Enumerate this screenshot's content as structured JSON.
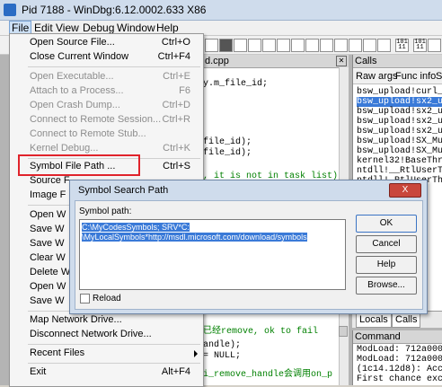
{
  "window": {
    "title": "Pid 7188 - WinDbg:6.12.0002.633 X86"
  },
  "menubar": [
    "File",
    "Edit",
    "View",
    "Debug",
    "Window",
    "Help"
  ],
  "toolbar_labels": [
    "101 11",
    "101 11"
  ],
  "source_pane": {
    "tab_title": "d.cpp",
    "lines": [
      "y.m_file_id;",
      "file_id);",
      "file_id);",
      ", it is not in task list)",
      "已经remove, ok to fail",
      "andle);",
      "= NULL;",
      "i_remove_handle会调用on_p"
    ]
  },
  "calls_pane": {
    "title": "Calls",
    "buttons": [
      "Raw args",
      "Func info",
      "S"
    ],
    "items": [
      "bsw_upload!curl_",
      "bsw_upload!sx2_u",
      "bsw_upload!sx2_u",
      "bsw_upload!sx2_u",
      "bsw_upload!sx2_u",
      "bsw_upload!SX_Mu",
      "bsw_upload!SX_Mu",
      "kernel32!BaseThr",
      "ntdll!__RtlUserT",
      "ntdll!_RtlUserThr"
    ]
  },
  "bottom_tabs": [
    "Locals",
    "Calls"
  ],
  "command_pane": {
    "title": "Command",
    "lines": [
      "ModLoad: 712a000",
      "ModLoad: 712a000",
      "(1c14.12d8): Acce",
      "First chance exce"
    ]
  },
  "file_menu": {
    "items": [
      {
        "label": "Open Source File...",
        "shortcut": "Ctrl+O",
        "disabled": false
      },
      {
        "label": "Close Current Window",
        "shortcut": "Ctrl+F4",
        "disabled": false
      },
      {
        "label": "Open Executable...",
        "shortcut": "Ctrl+E",
        "disabled": true
      },
      {
        "label": "Attach to a Process...",
        "shortcut": "F6",
        "disabled": true
      },
      {
        "label": "Open Crash Dump...",
        "shortcut": "Ctrl+D",
        "disabled": true
      },
      {
        "label": "Connect to Remote Session...",
        "shortcut": "Ctrl+R",
        "disabled": true
      },
      {
        "label": "Connect to Remote Stub...",
        "shortcut": "",
        "disabled": true
      },
      {
        "label": "Kernel Debug...",
        "shortcut": "Ctrl+K",
        "disabled": true
      },
      {
        "label": "Symbol File Path ...",
        "shortcut": "Ctrl+S",
        "disabled": false
      },
      {
        "label": "Source F",
        "shortcut": "",
        "disabled": false
      },
      {
        "label": "Image F",
        "shortcut": "",
        "disabled": false
      },
      {
        "label": "Open W",
        "shortcut": "",
        "disabled": false
      },
      {
        "label": "Save W",
        "shortcut": "",
        "disabled": false
      },
      {
        "label": "Save W",
        "shortcut": "",
        "disabled": false
      },
      {
        "label": "Clear W",
        "shortcut": "",
        "disabled": false
      },
      {
        "label": "Delete W",
        "shortcut": "",
        "disabled": false
      },
      {
        "label": "Open W",
        "shortcut": "",
        "disabled": false
      },
      {
        "label": "Save W",
        "shortcut": "",
        "disabled": false
      },
      {
        "label": "Map Network Drive...",
        "shortcut": "",
        "disabled": false
      },
      {
        "label": "Disconnect Network Drive...",
        "shortcut": "",
        "disabled": false
      },
      {
        "label": "Recent Files",
        "shortcut": "",
        "disabled": false
      },
      {
        "label": "Exit",
        "shortcut": "Alt+F4",
        "disabled": false
      }
    ]
  },
  "dialog": {
    "title": "Symbol Search Path",
    "close_label": "X",
    "field_label": "Symbol path:",
    "path_line1": "C:\\MyCodesSymbols; SRV*C:",
    "path_line2": "\\MyLocalSymbols*http://msdl.microsoft.com/download/symbols",
    "reload_label": "Reload",
    "reload_checked": false,
    "buttons": {
      "ok": "OK",
      "cancel": "Cancel",
      "help": "Help",
      "browse": "Browse..."
    }
  }
}
